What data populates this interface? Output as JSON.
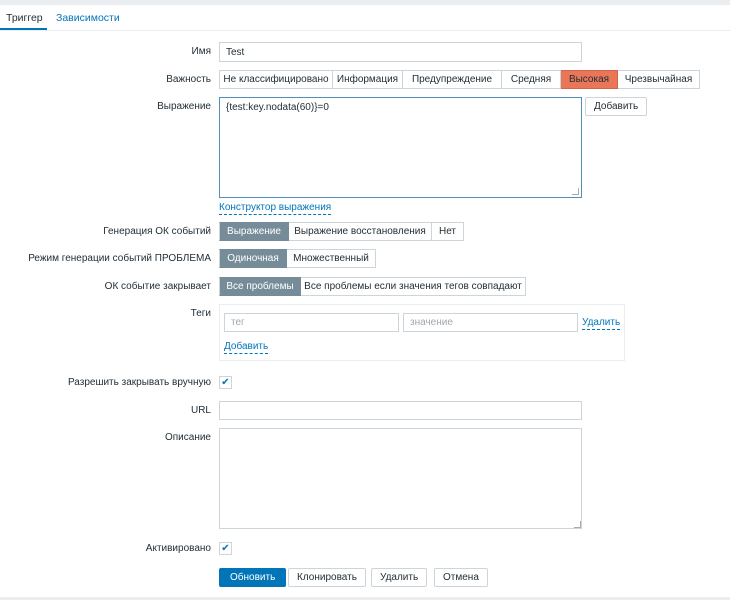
{
  "tabs": [
    {
      "label": "Триггер",
      "active": true
    },
    {
      "label": "Зависимости",
      "active": false
    }
  ],
  "form": {
    "name_label": "Имя",
    "name_value": "Test",
    "severity_label": "Важность",
    "severity_options": [
      "Не классифицировано",
      "Информация",
      "Предупреждение",
      "Средняя",
      "Высокая",
      "Чрезвычайная"
    ],
    "severity_selected": "Высокая",
    "expression_label": "Выражение",
    "expression_value": "{test:key.nodata(60)}=0",
    "expression_add": "Добавить",
    "constructor_link": "Конструктор выражения",
    "ok_gen_label": "Генерация ОК событий",
    "ok_gen_options": [
      "Выражение",
      "Выражение восстановления",
      "Нет"
    ],
    "problem_mode_label": "Режим генерации событий ПРОБЛЕМА",
    "problem_mode_options": [
      "Одиночная",
      "Множественный"
    ],
    "ok_close_label": "ОК событие закрывает",
    "ok_close_options": [
      "Все проблемы",
      "Все проблемы если значения тегов совпадают"
    ],
    "tags_label": "Теги",
    "tag_placeholder": "тег",
    "value_placeholder": "значение",
    "tag_remove": "Удалить",
    "tag_add": "Добавить",
    "manual_close_label": "Разрешить закрывать вручную",
    "manual_close_checked": true,
    "url_label": "URL",
    "url_value": "",
    "description_label": "Описание",
    "description_value": "",
    "enabled_label": "Активировано",
    "enabled_checked": true
  },
  "buttons": {
    "update": "Обновить",
    "clone": "Клонировать",
    "delete": "Удалить",
    "cancel": "Отмена"
  },
  "colors": {
    "accent": "#0275b8",
    "high": "#e97659",
    "selected": "#768d99"
  }
}
